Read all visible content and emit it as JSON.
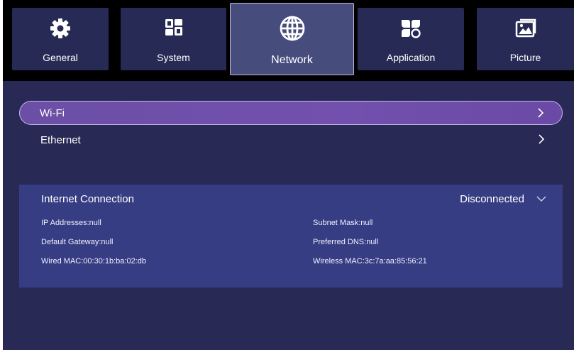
{
  "tabs": [
    {
      "label": "General",
      "icon": "gear-icon"
    },
    {
      "label": "System",
      "icon": "windows-grid-icon"
    },
    {
      "label": "Network",
      "icon": "globe-icon",
      "active": true
    },
    {
      "label": "Application",
      "icon": "apps-icon"
    },
    {
      "label": "Picture",
      "icon": "picture-icon"
    }
  ],
  "menu": [
    {
      "label": "Wi-Fi",
      "selected": true
    },
    {
      "label": "Ethernet",
      "selected": false
    }
  ],
  "connection": {
    "title": "Internet Connection",
    "status": "Disconnected",
    "ip_addresses": "IP Addresses:null",
    "subnet_mask": "Subnet Mask:null",
    "default_gateway": "Default Gateway:null",
    "preferred_dns": "Preferred DNS:null",
    "wired_mac": "Wired MAC:00:30:1b:ba:02:db",
    "wireless_mac": "Wireless MAC:3c:7a:aa:85:56:21"
  },
  "colors": {
    "background": "#282a55",
    "top_band": "#000000",
    "tab": "#262a54",
    "tab_active": "#464c7c",
    "selected_item": "#7250ad",
    "panel": "#373d83"
  }
}
